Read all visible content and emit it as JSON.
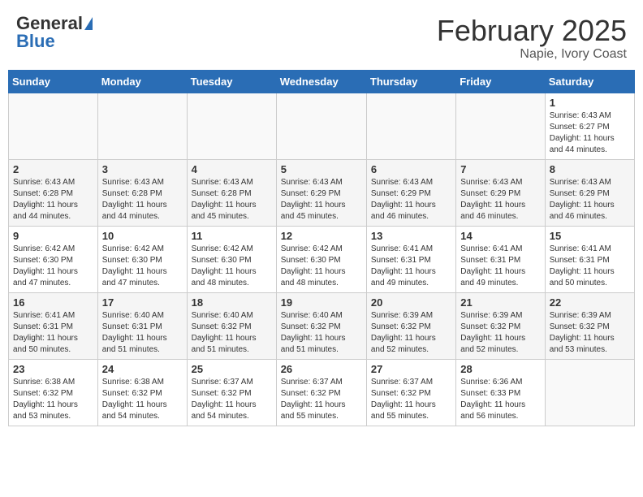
{
  "header": {
    "logo_general": "General",
    "logo_blue": "Blue",
    "month_title": "February 2025",
    "location": "Napie, Ivory Coast"
  },
  "weekdays": [
    "Sunday",
    "Monday",
    "Tuesday",
    "Wednesday",
    "Thursday",
    "Friday",
    "Saturday"
  ],
  "weeks": [
    [
      {
        "day": "",
        "info": ""
      },
      {
        "day": "",
        "info": ""
      },
      {
        "day": "",
        "info": ""
      },
      {
        "day": "",
        "info": ""
      },
      {
        "day": "",
        "info": ""
      },
      {
        "day": "",
        "info": ""
      },
      {
        "day": "1",
        "info": "Sunrise: 6:43 AM\nSunset: 6:27 PM\nDaylight: 11 hours\nand 44 minutes."
      }
    ],
    [
      {
        "day": "2",
        "info": "Sunrise: 6:43 AM\nSunset: 6:28 PM\nDaylight: 11 hours\nand 44 minutes."
      },
      {
        "day": "3",
        "info": "Sunrise: 6:43 AM\nSunset: 6:28 PM\nDaylight: 11 hours\nand 44 minutes."
      },
      {
        "day": "4",
        "info": "Sunrise: 6:43 AM\nSunset: 6:28 PM\nDaylight: 11 hours\nand 45 minutes."
      },
      {
        "day": "5",
        "info": "Sunrise: 6:43 AM\nSunset: 6:29 PM\nDaylight: 11 hours\nand 45 minutes."
      },
      {
        "day": "6",
        "info": "Sunrise: 6:43 AM\nSunset: 6:29 PM\nDaylight: 11 hours\nand 46 minutes."
      },
      {
        "day": "7",
        "info": "Sunrise: 6:43 AM\nSunset: 6:29 PM\nDaylight: 11 hours\nand 46 minutes."
      },
      {
        "day": "8",
        "info": "Sunrise: 6:43 AM\nSunset: 6:29 PM\nDaylight: 11 hours\nand 46 minutes."
      }
    ],
    [
      {
        "day": "9",
        "info": "Sunrise: 6:42 AM\nSunset: 6:30 PM\nDaylight: 11 hours\nand 47 minutes."
      },
      {
        "day": "10",
        "info": "Sunrise: 6:42 AM\nSunset: 6:30 PM\nDaylight: 11 hours\nand 47 minutes."
      },
      {
        "day": "11",
        "info": "Sunrise: 6:42 AM\nSunset: 6:30 PM\nDaylight: 11 hours\nand 48 minutes."
      },
      {
        "day": "12",
        "info": "Sunrise: 6:42 AM\nSunset: 6:30 PM\nDaylight: 11 hours\nand 48 minutes."
      },
      {
        "day": "13",
        "info": "Sunrise: 6:41 AM\nSunset: 6:31 PM\nDaylight: 11 hours\nand 49 minutes."
      },
      {
        "day": "14",
        "info": "Sunrise: 6:41 AM\nSunset: 6:31 PM\nDaylight: 11 hours\nand 49 minutes."
      },
      {
        "day": "15",
        "info": "Sunrise: 6:41 AM\nSunset: 6:31 PM\nDaylight: 11 hours\nand 50 minutes."
      }
    ],
    [
      {
        "day": "16",
        "info": "Sunrise: 6:41 AM\nSunset: 6:31 PM\nDaylight: 11 hours\nand 50 minutes."
      },
      {
        "day": "17",
        "info": "Sunrise: 6:40 AM\nSunset: 6:31 PM\nDaylight: 11 hours\nand 51 minutes."
      },
      {
        "day": "18",
        "info": "Sunrise: 6:40 AM\nSunset: 6:32 PM\nDaylight: 11 hours\nand 51 minutes."
      },
      {
        "day": "19",
        "info": "Sunrise: 6:40 AM\nSunset: 6:32 PM\nDaylight: 11 hours\nand 51 minutes."
      },
      {
        "day": "20",
        "info": "Sunrise: 6:39 AM\nSunset: 6:32 PM\nDaylight: 11 hours\nand 52 minutes."
      },
      {
        "day": "21",
        "info": "Sunrise: 6:39 AM\nSunset: 6:32 PM\nDaylight: 11 hours\nand 52 minutes."
      },
      {
        "day": "22",
        "info": "Sunrise: 6:39 AM\nSunset: 6:32 PM\nDaylight: 11 hours\nand 53 minutes."
      }
    ],
    [
      {
        "day": "23",
        "info": "Sunrise: 6:38 AM\nSunset: 6:32 PM\nDaylight: 11 hours\nand 53 minutes."
      },
      {
        "day": "24",
        "info": "Sunrise: 6:38 AM\nSunset: 6:32 PM\nDaylight: 11 hours\nand 54 minutes."
      },
      {
        "day": "25",
        "info": "Sunrise: 6:37 AM\nSunset: 6:32 PM\nDaylight: 11 hours\nand 54 minutes."
      },
      {
        "day": "26",
        "info": "Sunrise: 6:37 AM\nSunset: 6:32 PM\nDaylight: 11 hours\nand 55 minutes."
      },
      {
        "day": "27",
        "info": "Sunrise: 6:37 AM\nSunset: 6:32 PM\nDaylight: 11 hours\nand 55 minutes."
      },
      {
        "day": "28",
        "info": "Sunrise: 6:36 AM\nSunset: 6:33 PM\nDaylight: 11 hours\nand 56 minutes."
      },
      {
        "day": "",
        "info": ""
      }
    ]
  ]
}
